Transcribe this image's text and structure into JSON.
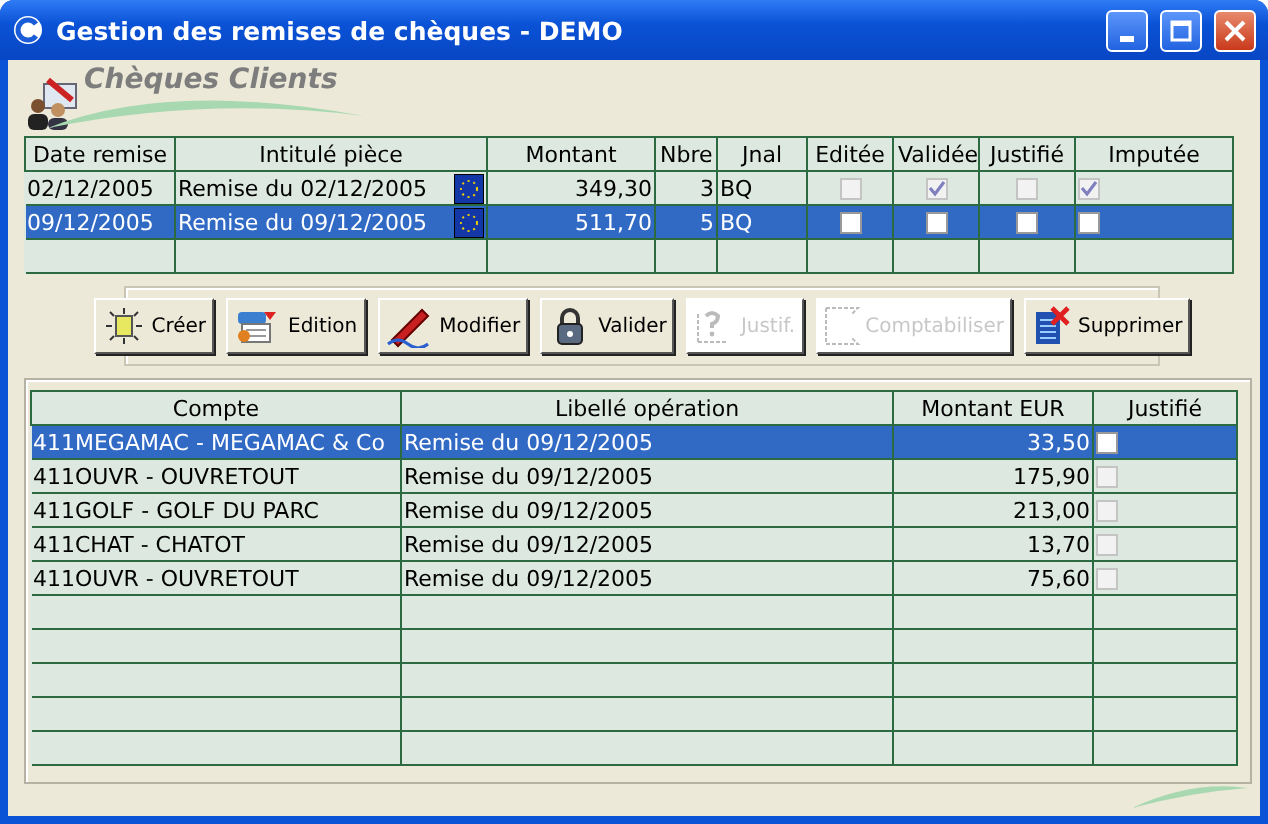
{
  "window": {
    "title": "Gestion des remises de chèques - DEMO"
  },
  "header": {
    "title": "Chèques Clients"
  },
  "remises": {
    "columns": [
      "Date remise",
      "Intitulé pièce",
      "Montant",
      "Nbre",
      "Jnal",
      "Editée",
      "Validée",
      "Justifié",
      "Imputée"
    ],
    "rows": [
      {
        "date": "02/12/2005",
        "intitule": "Remise du 02/12/2005",
        "montant": "349,30",
        "nbre": "3",
        "jnal": "BQ",
        "editee": false,
        "validee": true,
        "justifie": false,
        "imputee": true,
        "selected": false
      },
      {
        "date": "09/12/2005",
        "intitule": "Remise du 09/12/2005",
        "montant": "511,70",
        "nbre": "5",
        "jnal": "BQ",
        "editee": false,
        "validee": false,
        "justifie": false,
        "imputee": false,
        "selected": true
      }
    ]
  },
  "toolbar": [
    {
      "kind": "create",
      "label": "Créer",
      "disabled": false
    },
    {
      "kind": "edit",
      "label": "Edition",
      "disabled": false
    },
    {
      "kind": "modify",
      "label": "Modifier",
      "disabled": false
    },
    {
      "kind": "validate",
      "label": "Valider",
      "disabled": false
    },
    {
      "kind": "justify",
      "label": "Justif.",
      "disabled": true
    },
    {
      "kind": "post",
      "label": "Comptabiliser",
      "disabled": true
    },
    {
      "kind": "delete",
      "label": "Supprimer",
      "disabled": false
    }
  ],
  "lignes": {
    "columns": [
      "Compte",
      "Libellé opération",
      "Montant EUR",
      "Justifié"
    ],
    "rows": [
      {
        "compte": "411MEGAMAC - MEGAMAC & Co",
        "libelle": "Remise du 09/12/2005",
        "montant": "33,50",
        "justifie": false,
        "selected": true
      },
      {
        "compte": "411OUVR - OUVRETOUT",
        "libelle": "Remise du 09/12/2005",
        "montant": "175,90",
        "justifie": false,
        "selected": false
      },
      {
        "compte": "411GOLF - GOLF DU PARC",
        "libelle": "Remise du 09/12/2005",
        "montant": "213,00",
        "justifie": false,
        "selected": false
      },
      {
        "compte": "411CHAT - CHATOT",
        "libelle": "Remise du 09/12/2005",
        "montant": "13,70",
        "justifie": false,
        "selected": false
      },
      {
        "compte": "411OUVR - OUVRETOUT",
        "libelle": "Remise du 09/12/2005",
        "montant": "75,60",
        "justifie": false,
        "selected": false
      }
    ]
  }
}
